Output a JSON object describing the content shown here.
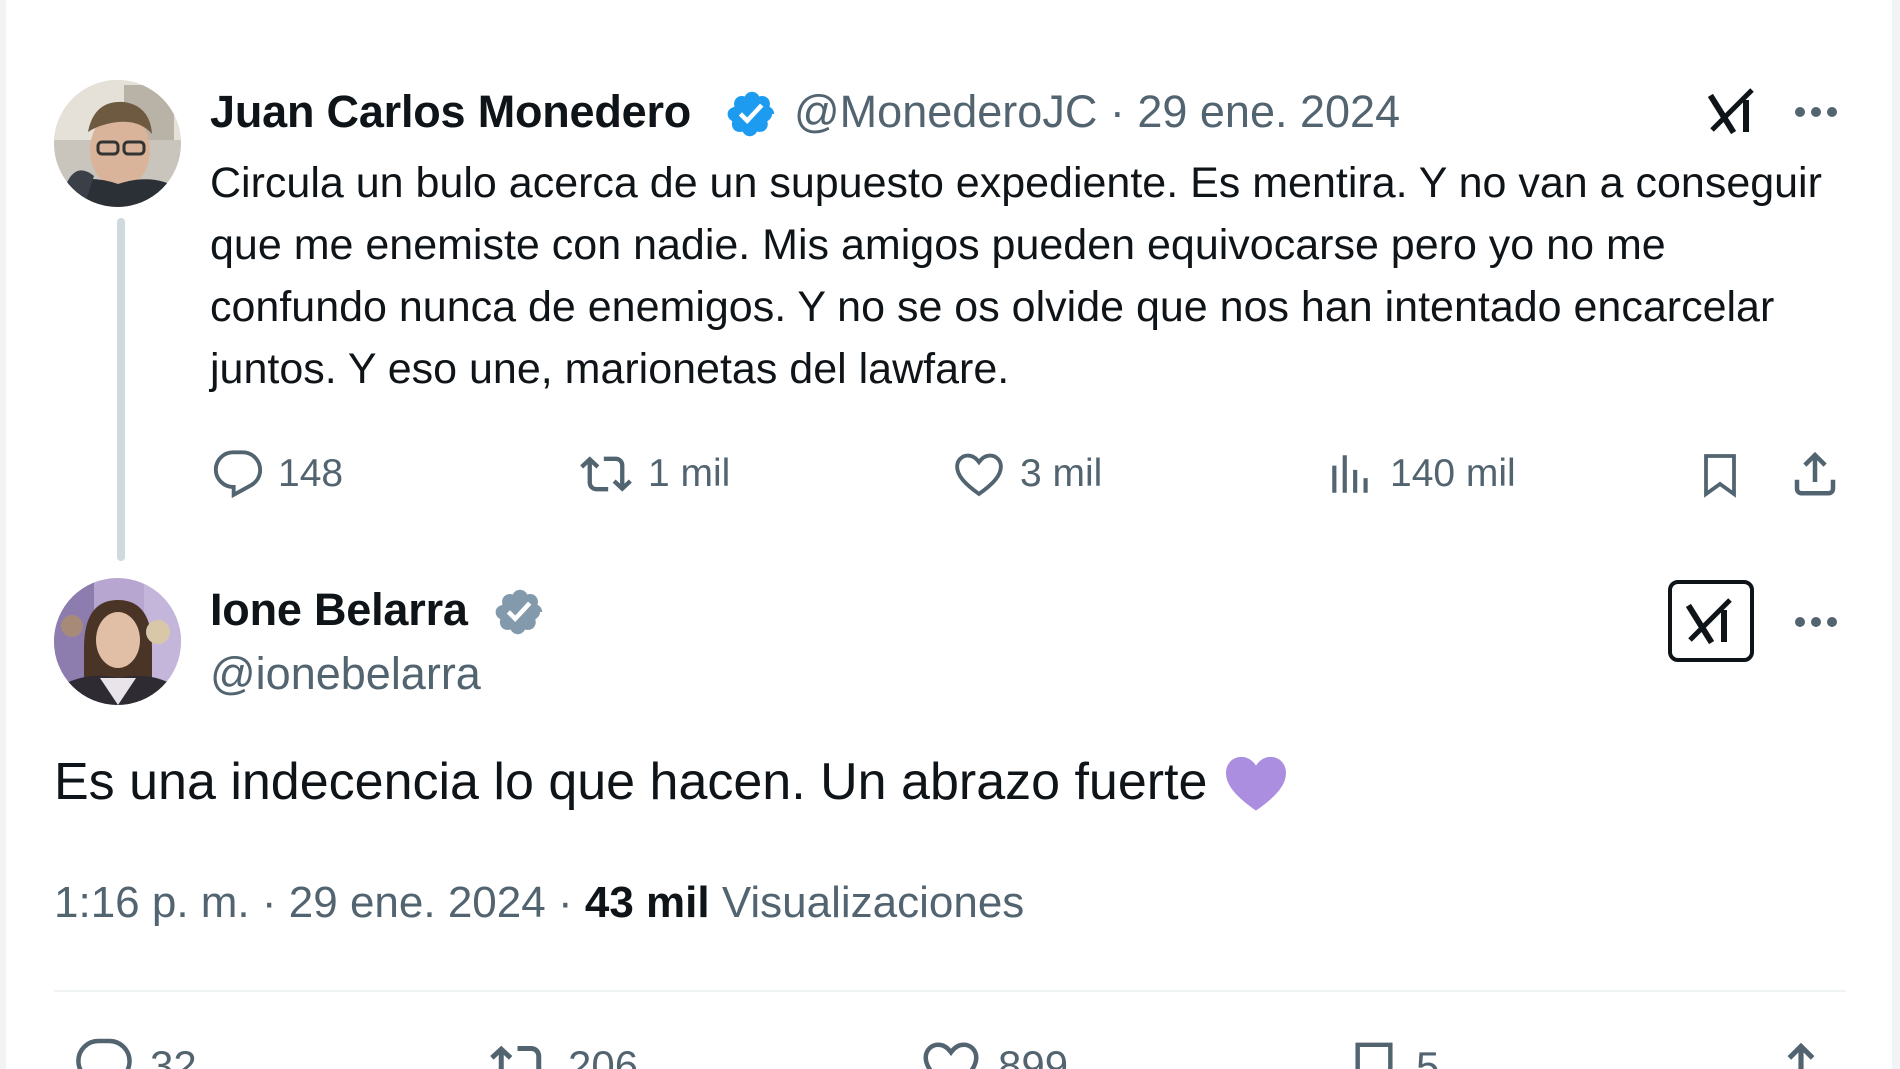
{
  "tweet1": {
    "author_name": "Juan Carlos Monedero",
    "handle": "@MonederoJC",
    "separator": "·",
    "date": "29 ene. 2024",
    "text": "Circula un bulo acerca de un supuesto expediente. Es mentira. Y no van a conseguir que me enemiste con nadie. Mis amigos pueden equivocarse pero yo no me confundo nunca de enemigos. Y no se os olvide que nos han intentado encarcelar juntos. Y eso une, marionetas del lawfare.",
    "verified_color": "#1d9bf0",
    "replies": "148",
    "reposts": "1 mil",
    "likes": "3 mil",
    "views": "140 mil"
  },
  "tweet2": {
    "author_name": "Ione Belarra",
    "handle": "@ionebelarra",
    "verified_color": "#829aab",
    "text": "Es una indecencia lo que hacen. Un abrazo fuerte",
    "emoji": "purple-heart",
    "emoji_color": "#ab8ee0",
    "time": "1:16 p. m.",
    "separator": "·",
    "date": "29 ene. 2024",
    "views_count": "43 mil",
    "views_label": "Visualizaciones",
    "replies": "32",
    "reposts": "206",
    "likes": "899",
    "bookmarks": "5"
  },
  "colors": {
    "text": "#0f1419",
    "secondary": "#536471",
    "thread_line": "#cfd9de",
    "divider": "#eff3f4"
  },
  "icons": {
    "grok": "grok-icon",
    "more": "more-icon",
    "reply": "reply-icon",
    "repost": "repost-icon",
    "like": "like-icon",
    "views": "views-icon",
    "bookmark": "bookmark-icon",
    "share": "share-icon",
    "verified": "verified-badge-icon"
  }
}
